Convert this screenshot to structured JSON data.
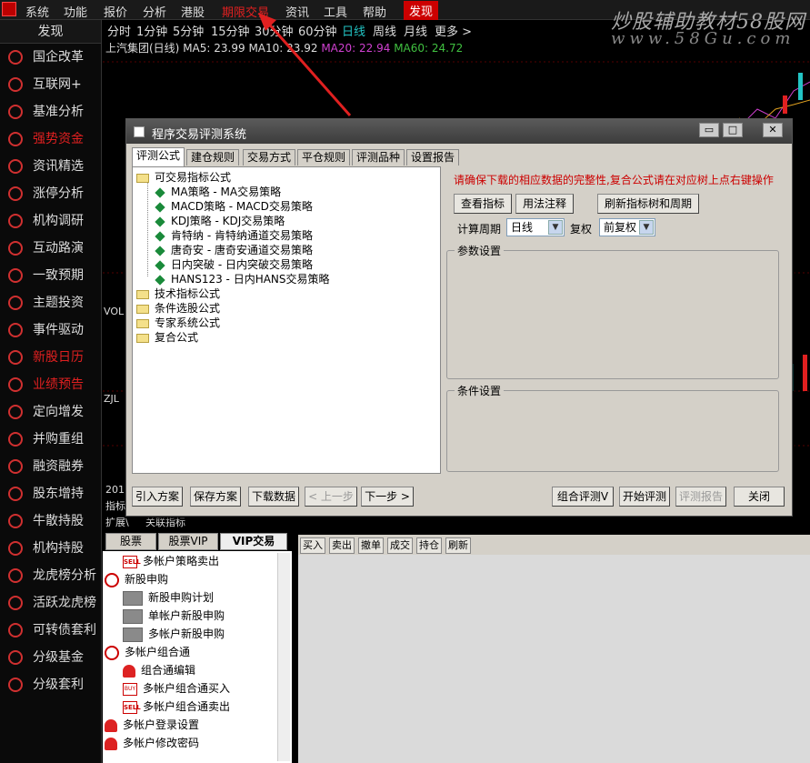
{
  "menubar": {
    "items": [
      "系统",
      "功能",
      "报价",
      "分析",
      "港股",
      "期限交易",
      "资讯",
      "工具",
      "帮助"
    ],
    "discover": "发现",
    "watermark": "炒股辅助教材58股网",
    "watermark_url": "www.58Gu.com"
  },
  "sidebar": {
    "title": "发现",
    "items": [
      "国企改革",
      "互联网+",
      "基准分析",
      "强势资金",
      "资讯精选",
      "涨停分析",
      "机构调研",
      "互动路演",
      "一致预期",
      "主题投资",
      "事件驱动",
      "新股日历",
      "业绩预告",
      "定向增发",
      "并购重组",
      "融资融券",
      "股东增持",
      "牛散持股",
      "机构持股",
      "龙虎榜分析",
      "活跃龙虎榜",
      "可转债套利",
      "分级基金",
      "分级套利"
    ]
  },
  "periods": [
    "分时",
    "1分钟",
    "5分钟",
    "15分钟",
    "30分钟",
    "60分钟",
    "日线",
    "周线",
    "月线",
    "更多 >"
  ],
  "ma": {
    "stock": "上汽集团(日线)",
    "ma5": "MA5: 23.99",
    "ma10": "MA10: 23.92",
    "ma20": "MA20: 22.94",
    "ma60": "MA60: 24.72"
  },
  "chart_labels": {
    "vol": "VOL",
    "zjl": "ZJL",
    "year": "201",
    "indicator": "指标",
    "expand": "扩展\\",
    "tab": "关联指标"
  },
  "dialog": {
    "title": "程序交易评测系统",
    "tabs": [
      "评测公式",
      "建仓规则",
      "交易方式",
      "平仓规则",
      "评测品种",
      "设置报告"
    ],
    "tree": {
      "root": "可交易指标公式",
      "children": [
        "MA策略 - MA交易策略",
        "MACD策略 - MACD交易策略",
        "KDJ策略 - KDJ交易策略",
        "肯特纳 - 肯特纳通道交易策略",
        "唐奇安 - 唐奇安通道交易策略",
        "日内突破 - 日内突破交易策略",
        "HANS123 - 日内HANS交易策略"
      ],
      "folders": [
        "技术指标公式",
        "条件选股公式",
        "专家系统公式",
        "复合公式"
      ]
    },
    "notice": "请确保下载的相应数据的完整性,复合公式请在对应树上点右键操作",
    "buttons": {
      "view": "查看指标",
      "usage": "用法注释",
      "refresh": "刷新指标树和周期"
    },
    "period_label": "计算周期",
    "period_value": "日线",
    "fq_label": "复权",
    "fq_value": "前复权",
    "param_group": "参数设置",
    "cond_group": "条件设置",
    "footer": {
      "import": "引入方案",
      "save": "保存方案",
      "download": "下载数据",
      "prev": "< 上一步",
      "next": "下一步 >",
      "combo": "组合评测V",
      "start": "开始评测",
      "report": "评测报告",
      "close": "关闭"
    }
  },
  "bottom": {
    "tabs": [
      "股票",
      "股票VIP",
      "VIP交易"
    ],
    "tree": [
      "多帐户策略卖出",
      "新股申购",
      "新股申购计划",
      "单帐户新股申购",
      "多帐户新股申购",
      "多帐户组合通",
      "组合通编辑",
      "多帐户组合通买入",
      "多帐户组合通卖出",
      "多帐户登录设置",
      "多帐户修改密码"
    ],
    "icon_text": {
      "sell": "SELL",
      "buy": "BUY"
    },
    "trade_buttons": [
      "买入",
      "卖出",
      "撤单",
      "成交",
      "持仓",
      "刷新"
    ]
  },
  "colors": {
    "red": "#e02020",
    "cyan": "#22c4c4",
    "bg": "#000000",
    "dialog": "#d4d0c8"
  }
}
